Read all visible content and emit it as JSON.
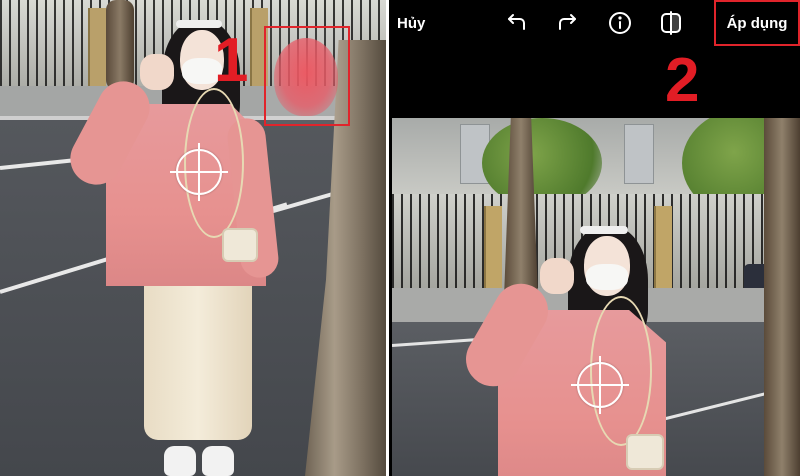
{
  "toolbar": {
    "cancel_label": "Hủy",
    "apply_label": "Áp dụng",
    "icons": [
      "undo-icon",
      "redo-icon",
      "info-icon",
      "compare-icon"
    ]
  },
  "annotations": {
    "marker_1": "1",
    "marker_2": "2"
  },
  "colors": {
    "highlight": "#e0242b",
    "toolbar_bg": "#000000",
    "toolbar_text": "#ffffff",
    "blur_patch": "#ee5660"
  }
}
